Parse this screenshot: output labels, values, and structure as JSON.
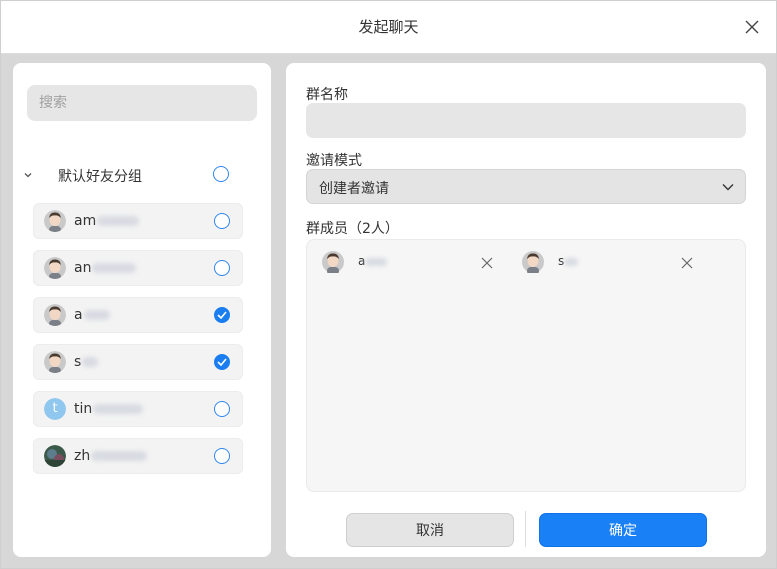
{
  "window": {
    "title": "发起聊天"
  },
  "left": {
    "search_placeholder": "搜索",
    "group": {
      "label": "默认好友分组",
      "checked": false
    },
    "contacts": [
      {
        "prefix": "am",
        "avatar": "person-avatar",
        "checked": false
      },
      {
        "prefix": "an",
        "avatar": "person-avatar",
        "checked": false
      },
      {
        "prefix": "a",
        "avatar": "person-avatar",
        "checked": true
      },
      {
        "prefix": "s",
        "avatar": "person-avatar",
        "checked": true
      },
      {
        "prefix": "tin",
        "avatar": "letter-avatar",
        "avatar_letter": "t",
        "checked": false
      },
      {
        "prefix": "zh",
        "avatar": "photo-avatar",
        "checked": false
      }
    ]
  },
  "right": {
    "group_name_label": "群名称",
    "group_name_value": "",
    "invite_mode_label": "邀请模式",
    "invite_mode_value": "创建者邀请",
    "members_label": "群成员（2人）",
    "members": [
      {
        "prefix": "a"
      },
      {
        "prefix": "s"
      }
    ],
    "cancel_label": "取消",
    "ok_label": "确定"
  },
  "colors": {
    "accent": "#1a80f5",
    "panel": "#ffffff",
    "backdrop": "#d7d7d7"
  },
  "icons": {
    "close": "close-icon",
    "chevron": "chevron-down-icon",
    "remove": "remove-x-icon",
    "check": "check-icon"
  }
}
